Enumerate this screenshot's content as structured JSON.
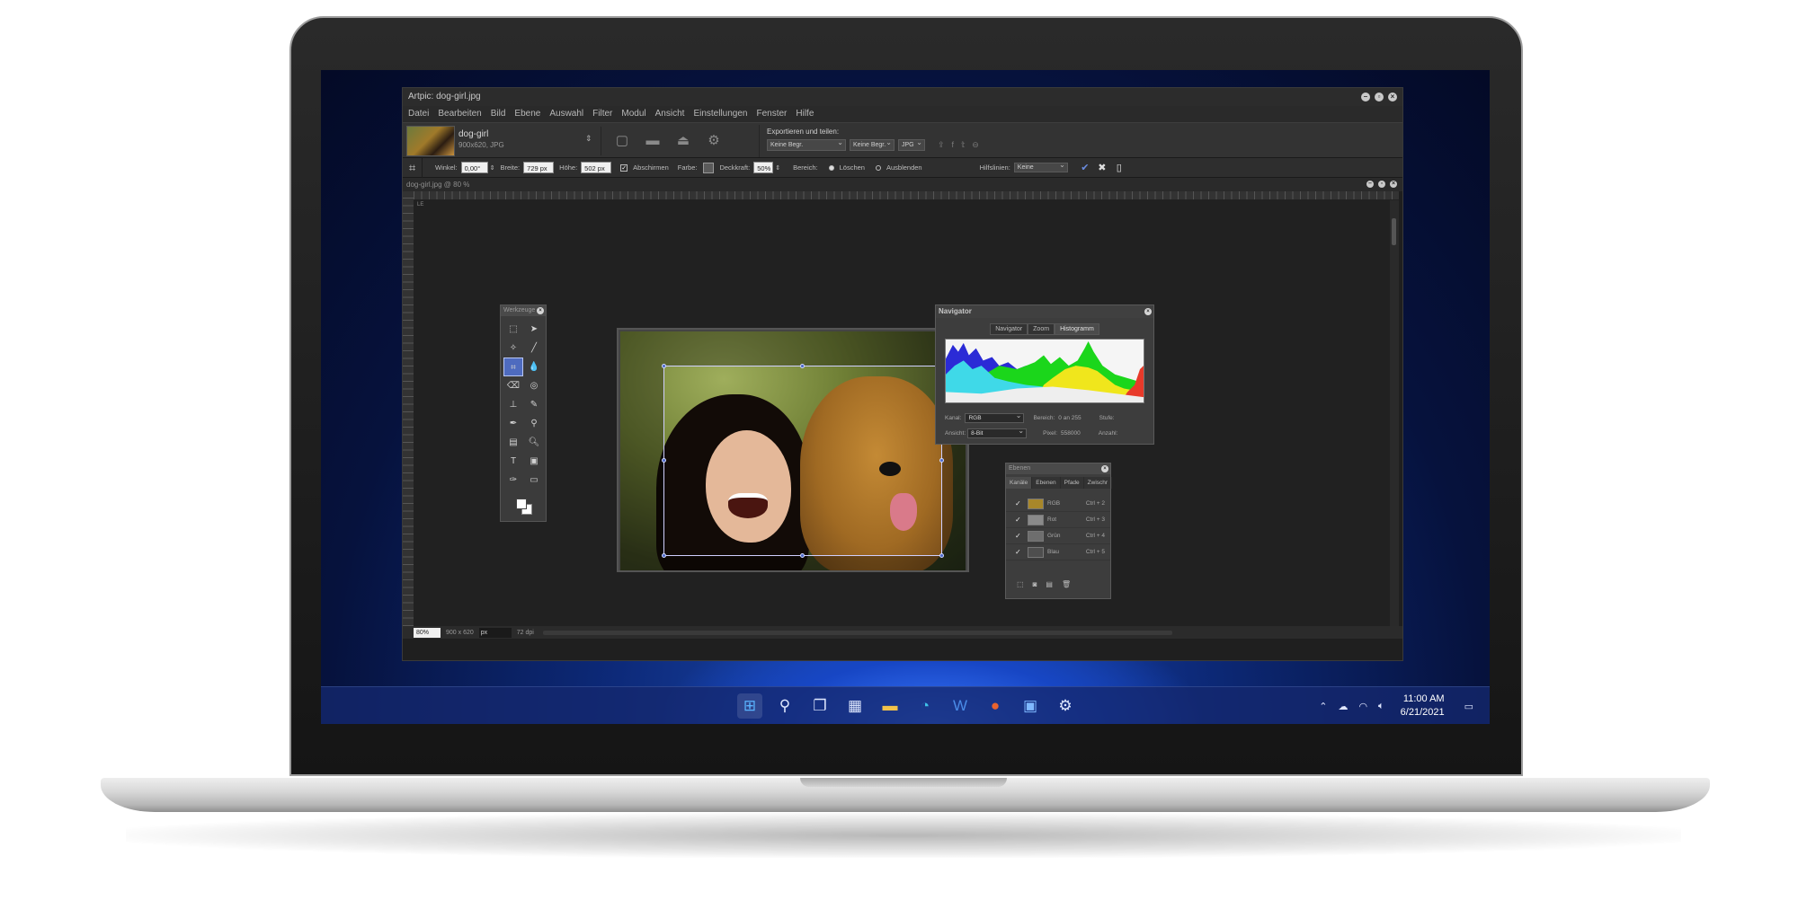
{
  "app": {
    "title": "Artpic: dog-girl.jpg",
    "menu": [
      "Datei",
      "Bearbeiten",
      "Bild",
      "Ebene",
      "Auswahl",
      "Filter",
      "Modul",
      "Ansicht",
      "Einstellungen",
      "Fenster",
      "Hilfe"
    ]
  },
  "document": {
    "name": "dog-girl",
    "info": "900x620, JPG",
    "window_title": "dog-girl.jpg @ 80 %"
  },
  "export": {
    "title": "Exportieren und teilen:",
    "select1": "Keine Begr.",
    "select2": "Keine Begr.",
    "format": "JPG"
  },
  "options": {
    "angle_label": "Winkel:",
    "angle_value": "0,00°",
    "width_label": "Breite:",
    "width_value": "729 px",
    "height_label": "Höhe:",
    "height_value": "502 px",
    "shade_label": "Abschirmen",
    "color_label": "Farbe:",
    "opacity_label": "Deckkraft:",
    "opacity_value": "50%",
    "area_label": "Bereich:",
    "delete_label": "Löschen",
    "hide_label": "Ausblenden",
    "guides_label": "Hilfslinien:",
    "guides_value": "Keine"
  },
  "status": {
    "zoom": "80%",
    "size": "900 x 620",
    "unit": "px",
    "dpi": "72 dpi"
  },
  "ruler": {
    "corner": "LE"
  },
  "tools_panel": {
    "title": "Werkzeuge"
  },
  "navigator": {
    "title": "Navigator",
    "tabs": [
      "Navigator",
      "Zoom",
      "Histogramm"
    ],
    "channel_label": "Kanal:",
    "channel_value": "RGB",
    "range_label": "Bereich:",
    "range_value": "0 an 255",
    "level_label": "Stufe:",
    "view_label": "Ansicht:",
    "view_value": "8-Bit",
    "pixel_label": "Pixel:",
    "pixel_value": "558000",
    "count_label": "Anzahl:"
  },
  "layers_panel": {
    "title": "Ebenen",
    "tabs": [
      "Kanäle",
      "Ebenen",
      "Pfade",
      "Zwischr"
    ],
    "channels": [
      {
        "name": "RGB",
        "shortcut": "Ctrl + 2",
        "thumb": "#a8872a"
      },
      {
        "name": "Rot",
        "shortcut": "Ctrl + 3",
        "thumb": "#8a8a8a"
      },
      {
        "name": "Grün",
        "shortcut": "Ctrl + 4",
        "thumb": "#6e6e6e"
      },
      {
        "name": "Blau",
        "shortcut": "Ctrl + 5",
        "thumb": "#4e4e4e"
      }
    ]
  },
  "taskbar": {
    "time": "11:00 AM",
    "date": "6/21/2021"
  },
  "colors": {
    "accent": "#4e6bbf",
    "app_bg": "#1f1f1f"
  }
}
